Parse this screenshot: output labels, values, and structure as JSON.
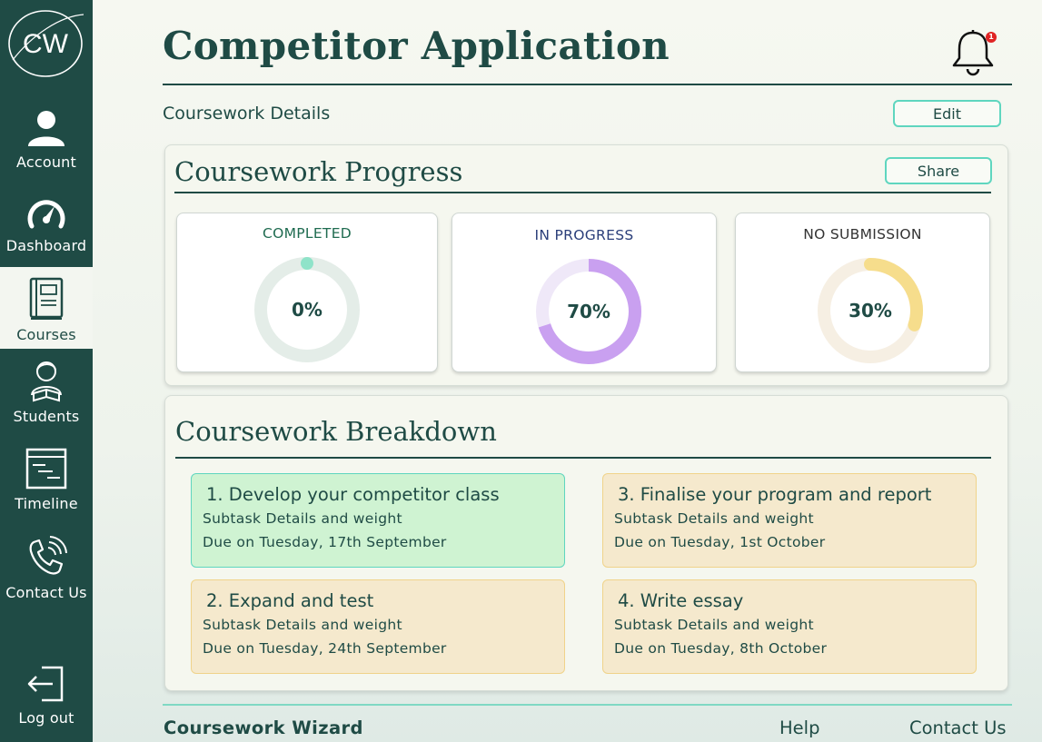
{
  "brand": {
    "logo_text": "CW"
  },
  "sidebar": {
    "items": [
      {
        "label": "Account",
        "icon": "user-icon"
      },
      {
        "label": "Dashboard",
        "icon": "speedometer-icon"
      },
      {
        "label": "Courses",
        "icon": "book-icon",
        "active": true
      },
      {
        "label": "Students",
        "icon": "student-icon"
      },
      {
        "label": "Timeline",
        "icon": "timeline-icon"
      },
      {
        "label": "Contact Us",
        "icon": "phone-icon"
      },
      {
        "label": "Log out",
        "icon": "logout-icon"
      }
    ]
  },
  "header": {
    "title": "Competitor Application",
    "notification_count": "1",
    "subtitle": "Coursework Details",
    "edit_label": "Edit"
  },
  "progress": {
    "title": "Coursework Progress",
    "share_label": "Share",
    "stats": [
      {
        "label": "COMPLETED",
        "value": "0%",
        "percent": 0,
        "color": "#8fe3c9",
        "track": "#e4ede8",
        "label_color": "#1f6b50"
      },
      {
        "label": "IN PROGRESS",
        "value": "70%",
        "percent": 70,
        "color": "#c9a0f0",
        "track": "#efe8f8",
        "label_color": "#2b3f7a"
      },
      {
        "label": "NO SUBMISSION",
        "value": "30%",
        "percent": 30,
        "color": "#f6dd8c",
        "track": "#f6efe3",
        "label_color": "#333333"
      }
    ]
  },
  "breakdown": {
    "title": "Coursework Breakdown",
    "tasks": [
      {
        "title": "1. Develop your competitor class",
        "subtitle": "Subtask Details and weight",
        "due": "Due on Tuesday, 17th September",
        "status": "green"
      },
      {
        "title": "3. Finalise your program and report",
        "subtitle": "Subtask Details and weight",
        "due": "Due on Tuesday, 1st October",
        "status": "amber"
      },
      {
        "title": "2. Expand and test",
        "subtitle": "Subtask Details and weight",
        "due": "Due on Tuesday, 24th September",
        "status": "amber"
      },
      {
        "title": "4. Write essay",
        "subtitle": "Subtask Details and weight",
        "due": "Due on Tuesday, 8th October",
        "status": "amber"
      }
    ]
  },
  "footer": {
    "brand": "Coursework Wizard",
    "help_label": "Help",
    "contact_label": "Contact Us"
  }
}
